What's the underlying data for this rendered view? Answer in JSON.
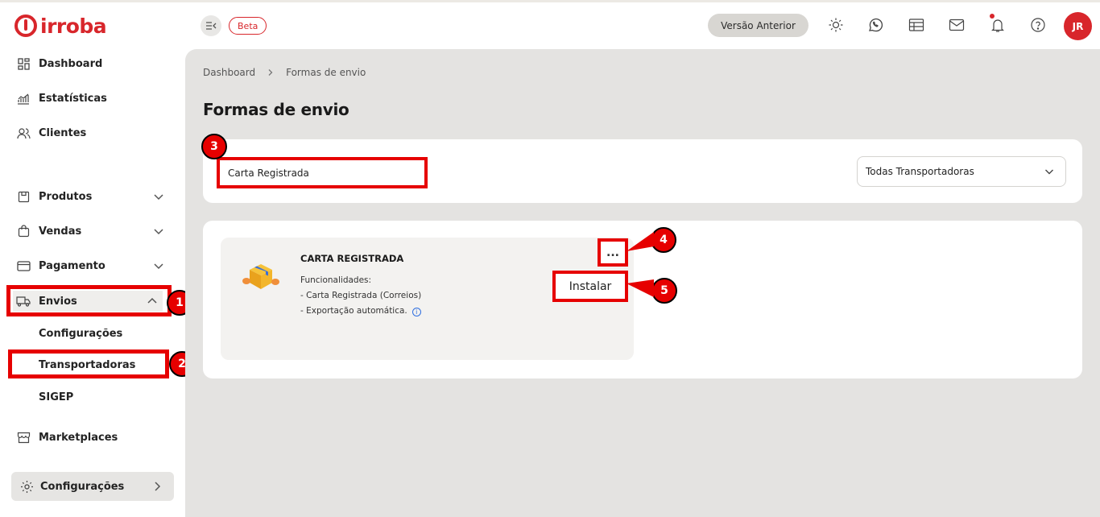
{
  "brand": {
    "logo_text": "irroba",
    "accent": "#d8262b"
  },
  "topbar": {
    "beta_label": "Beta",
    "previous_version_label": "Versão Anterior",
    "avatar_initials": "JR",
    "icons": [
      "sun-icon",
      "whatsapp-icon",
      "calendar-icon",
      "mail-icon",
      "bell-icon",
      "help-icon"
    ]
  },
  "sidebar": {
    "items": [
      {
        "label": "Dashboard",
        "icon": "grid-icon"
      },
      {
        "label": "Estatísticas",
        "icon": "chart-icon"
      },
      {
        "label": "Clientes",
        "icon": "users-icon"
      },
      {
        "label": "Produtos",
        "icon": "box-icon"
      },
      {
        "label": "Vendas",
        "icon": "bag-icon"
      },
      {
        "label": "Pagamento",
        "icon": "card-icon"
      },
      {
        "label": "Envios",
        "icon": "truck-icon"
      },
      {
        "label": "Marketplaces",
        "icon": "store-icon"
      }
    ],
    "envios_sub": [
      {
        "label": "Configurações"
      },
      {
        "label": "Transportadoras"
      },
      {
        "label": "SIGEP"
      }
    ],
    "config_label": "Configurações"
  },
  "breadcrumb": {
    "home": "Dashboard",
    "current": "Formas de envio"
  },
  "page_title": "Formas de envio",
  "filters": {
    "search_value": "Carta Registrada",
    "carrier_select": "Todas Transportadoras"
  },
  "carrier_card": {
    "name": "CARTA REGISTRADA",
    "features_title": "Funcionalidades:",
    "features": [
      "- Carta Registrada (Correios)",
      "- Exportação automática."
    ],
    "more_label": "...",
    "install_label": "Instalar"
  },
  "annotations": [
    "1",
    "2",
    "3",
    "4",
    "5"
  ],
  "annotation_color": "#e60000"
}
